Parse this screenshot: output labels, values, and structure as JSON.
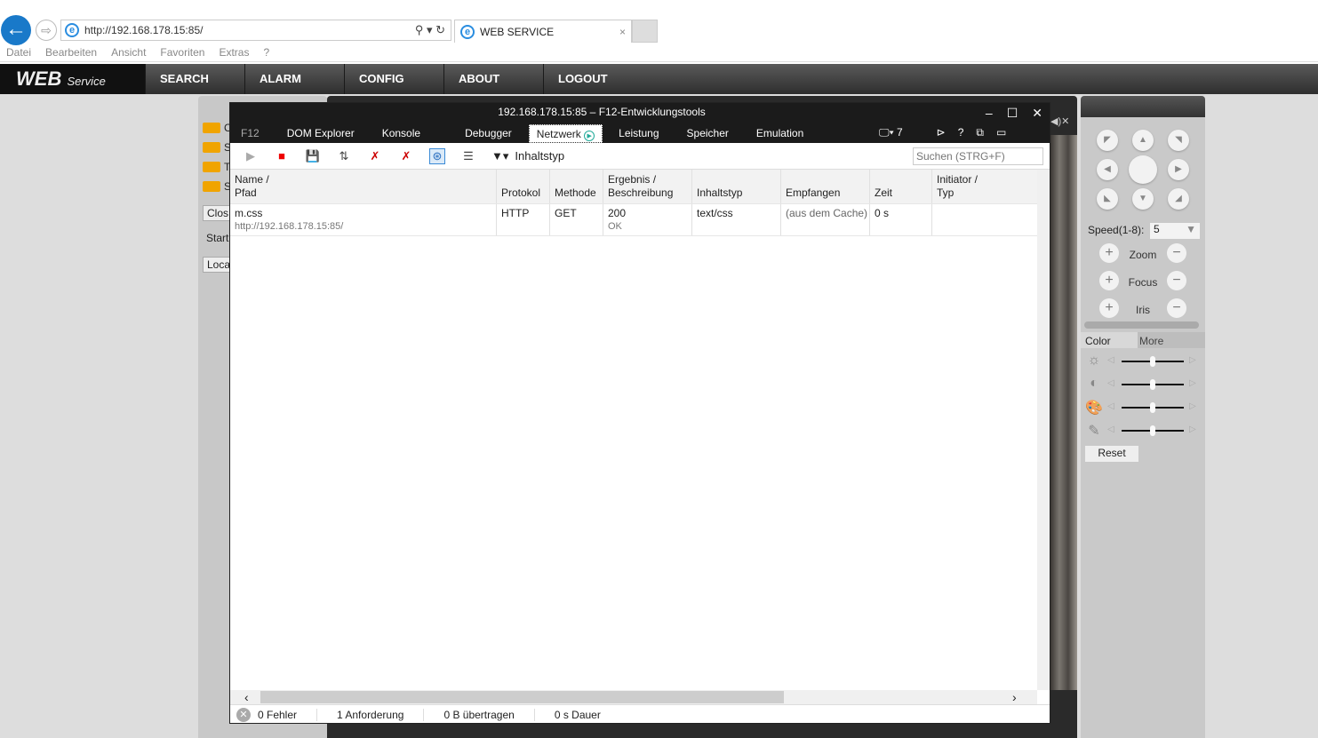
{
  "browser": {
    "url": "http://192.168.178.15:85/",
    "tab_title": "WEB SERVICE",
    "menu": [
      "Datei",
      "Bearbeiten",
      "Ansicht",
      "Favoriten",
      "Extras",
      "?"
    ]
  },
  "app": {
    "logo": "WEB",
    "logo_sub": "Service",
    "nav": [
      "SEARCH",
      "ALARM",
      "CONFIG",
      "ABOUT",
      "LOGOUT"
    ],
    "left_channels": [
      "C",
      "S",
      "T",
      "S"
    ],
    "left_buttons": [
      "Clos",
      "StartD",
      "Local"
    ]
  },
  "ptz": {
    "speed_label": "Speed(1-8):",
    "speed_value": "5",
    "zoom": "Zoom",
    "focus": "Focus",
    "iris": "Iris",
    "tabs": [
      "Color",
      "More"
    ],
    "reset": "Reset"
  },
  "devtools": {
    "title": "192.168.178.15:85 – F12-Entwicklungstools",
    "tabs": [
      "F12",
      "DOM Explorer",
      "Konsole",
      "Debugger",
      "Netzwerk",
      "Leistung",
      "Speicher",
      "Emulation"
    ],
    "emulation_count": "7",
    "filter_label": "Inhaltstyp",
    "search_placeholder": "Suchen (STRG+F)",
    "columns": [
      [
        "Name /",
        "Pfad"
      ],
      [
        "",
        "Protokol"
      ],
      [
        "",
        "Methode"
      ],
      [
        "Ergebnis /",
        "Beschreibung"
      ],
      [
        "",
        "Inhaltstyp"
      ],
      [
        "",
        "Empfangen"
      ],
      [
        "",
        "Zeit"
      ],
      [
        "Initiator /",
        "Typ"
      ]
    ],
    "rows": [
      {
        "name": "m.css",
        "path": "http://192.168.178.15:85/",
        "protocol": "HTTP",
        "method": "GET",
        "result": "200",
        "desc": "OK",
        "type": "text/css",
        "received": "(aus dem Cache)",
        "time": "0 s",
        "initiator": ""
      }
    ],
    "status": {
      "errors": "0 Fehler",
      "requests": "1 Anforderung",
      "transferred": "0 B übertragen",
      "duration": "0 s Dauer"
    }
  }
}
